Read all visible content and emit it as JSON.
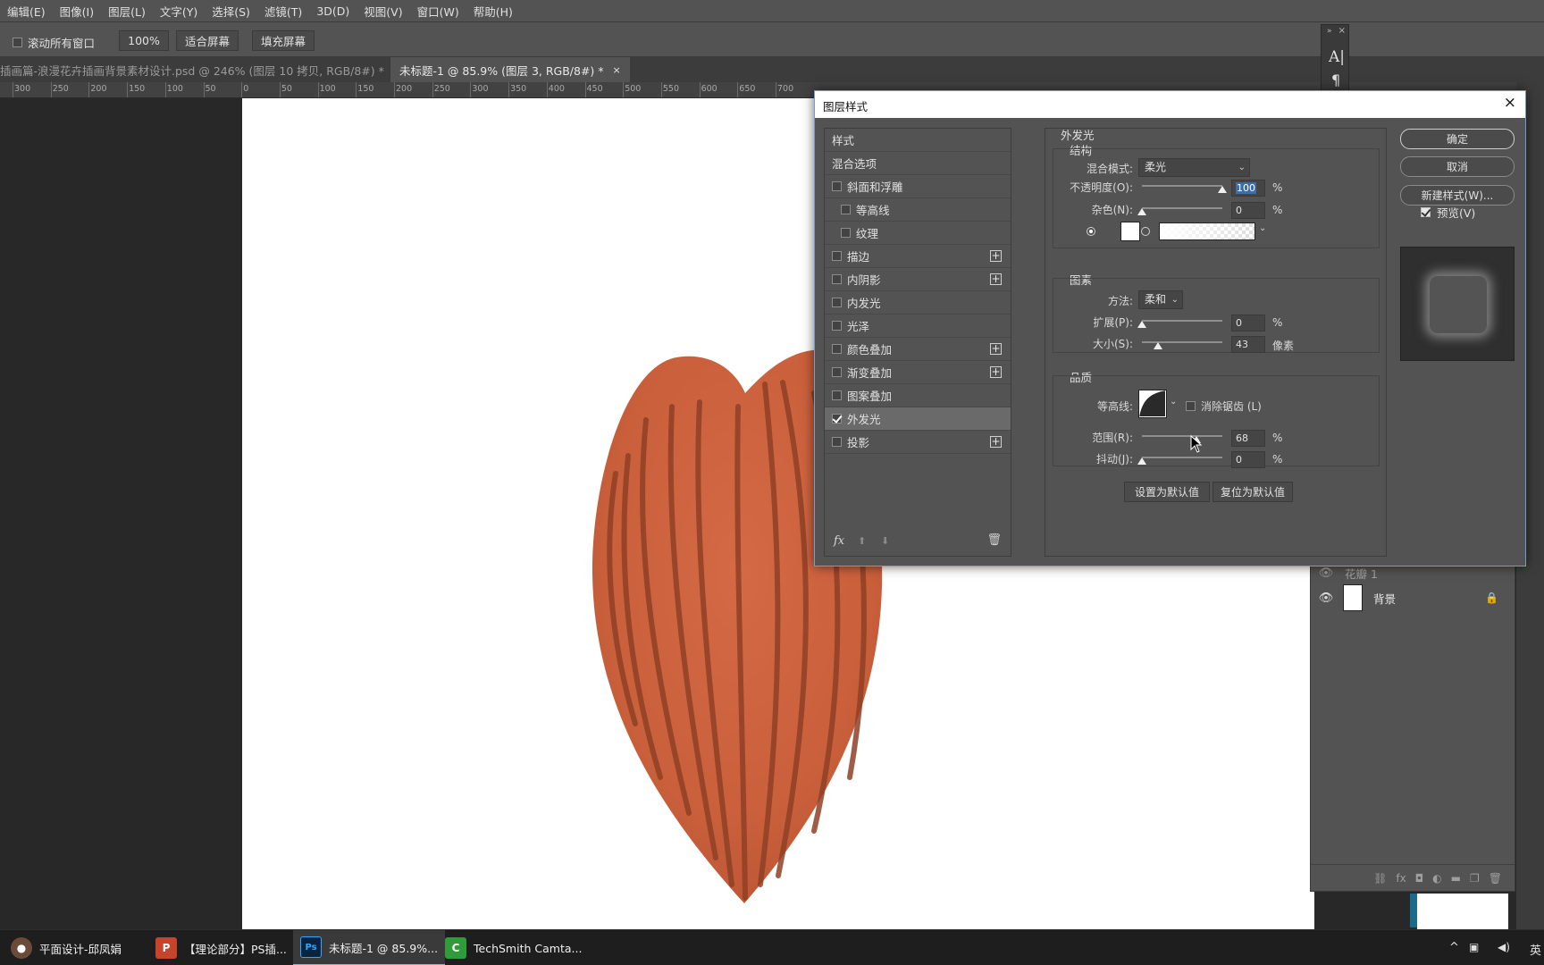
{
  "menu": [
    "编辑(E)",
    "图像(I)",
    "图层(L)",
    "文字(Y)",
    "选择(S)",
    "滤镜(T)",
    "3D(D)",
    "视图(V)",
    "窗口(W)",
    "帮助(H)"
  ],
  "options": {
    "scroll_all_windows": "滚动所有窗口",
    "zoom_button": "100%",
    "fit_screen": "适合屏幕",
    "fill_screen": "填充屏幕"
  },
  "tabs": [
    {
      "label": "插画篇-浪漫花卉插画背景素材设计.psd @ 246% (图层 10 拷贝, RGB/8#) *",
      "close": "×"
    },
    {
      "label": "未标题-1 @ 85.9% (图层 3, RGB/8#) *",
      "close": "×"
    }
  ],
  "ruler": {
    "labels": [
      "300",
      "250",
      "200",
      "150",
      "100",
      "50",
      "0",
      "50",
      "100",
      "150",
      "200",
      "250",
      "300",
      "350",
      "400",
      "450",
      "500",
      "550",
      "600",
      "650",
      "700"
    ]
  },
  "mini_panel": {
    "arrows": "»",
    "close": "×",
    "type_glyph": "A|",
    "para_glyph": "¶"
  },
  "layers": {
    "partial_name": "花瓣 1",
    "background_name": "背景",
    "eye": "👁",
    "lock": "🔒",
    "footer_icons": [
      "⛓",
      "fx",
      "◘",
      "◐",
      "▬",
      "❐",
      "🗑"
    ]
  },
  "dialog": {
    "title": "图层样式",
    "close": "×",
    "style_list": {
      "header": "样式",
      "blend_options": "混合选项",
      "items": [
        {
          "label": "斜面和浮雕",
          "checked": false,
          "indent": false,
          "plus": false
        },
        {
          "label": "等高线",
          "checked": false,
          "indent": true,
          "plus": false
        },
        {
          "label": "纹理",
          "checked": false,
          "indent": true,
          "plus": false
        },
        {
          "label": "描边",
          "checked": false,
          "indent": false,
          "plus": true
        },
        {
          "label": "内阴影",
          "checked": false,
          "indent": false,
          "plus": true
        },
        {
          "label": "内发光",
          "checked": false,
          "indent": false,
          "plus": false
        },
        {
          "label": "光泽",
          "checked": false,
          "indent": false,
          "plus": false
        },
        {
          "label": "颜色叠加",
          "checked": false,
          "indent": false,
          "plus": true
        },
        {
          "label": "渐变叠加",
          "checked": false,
          "indent": false,
          "plus": true
        },
        {
          "label": "图案叠加",
          "checked": false,
          "indent": false,
          "plus": false
        },
        {
          "label": "外发光",
          "checked": true,
          "indent": false,
          "plus": false,
          "selected": true
        },
        {
          "label": "投影",
          "checked": false,
          "indent": false,
          "plus": true
        }
      ],
      "plus_symbol": "+",
      "footer": {
        "fx": "fx",
        "up": "⬆",
        "down": "⬇",
        "trash": "🗑"
      }
    },
    "outer_glow": {
      "title": "外发光",
      "structure": {
        "title": "结构",
        "blend_mode_label": "混合模式:",
        "blend_mode_value": "柔光",
        "opacity_label": "不透明度(O):",
        "opacity_value": "100",
        "opacity_fraction": 1.0,
        "noise_label": "杂色(N):",
        "noise_value": "0",
        "noise_fraction": 0.0,
        "percent": "%"
      },
      "elements": {
        "title": "图素",
        "technique_label": "方法:",
        "technique_value": "柔和",
        "spread_label": "扩展(P):",
        "spread_value": "0",
        "spread_fraction": 0.0,
        "size_label": "大小(S):",
        "size_value": "43",
        "size_fraction": 0.2,
        "size_unit": "像素",
        "percent": "%"
      },
      "quality": {
        "title": "品质",
        "contour_label": "等高线:",
        "anti_alias_label": "消除锯齿 (L)",
        "range_label": "范围(R):",
        "range_value": "68",
        "range_fraction": 0.68,
        "jitter_label": "抖动(J):",
        "jitter_value": "0",
        "jitter_fraction": 0.0,
        "percent": "%"
      },
      "set_default": "设置为默认值",
      "reset_default": "复位为默认值",
      "dropdown_arrow": "⌄"
    },
    "buttons": {
      "ok": "确定",
      "cancel": "取消",
      "new_style": "新建样式(W)...",
      "preview": "预览(V)"
    }
  },
  "taskbar": {
    "items": [
      {
        "label": "平面设计-邱凤娟",
        "icon": "●"
      },
      {
        "label": "【理论部分】PS插...",
        "icon": "P"
      },
      {
        "label": "未标题-1 @ 85.9%...",
        "icon": "Ps"
      },
      {
        "label": "TechSmith Camta...",
        "icon": "C"
      }
    ],
    "tray_up": "^",
    "tray_ime": "英"
  },
  "colors": {
    "petal": "#cd6440",
    "petal_stripes": "#8e3f26",
    "accent_blue": "#6e9fd5"
  }
}
